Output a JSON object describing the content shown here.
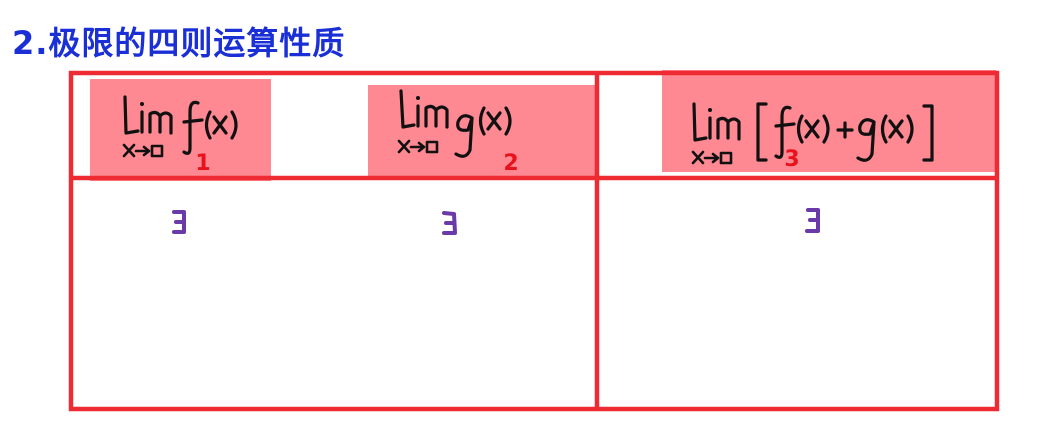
{
  "title": "2.极限的四则运算性质",
  "cells": [
    {
      "expression": "lim x→□ f(x)",
      "marker": "1",
      "content": "∃"
    },
    {
      "expression": "lim x→□ g(x)",
      "marker": "2",
      "content": "∃"
    },
    {
      "expression": "lim x→□ [f(x)+g(x)]",
      "marker": "3",
      "content": "∃"
    }
  ],
  "colors": {
    "title": "#1a2fd6",
    "grid": "#ee2b33",
    "highlight": "#ff3b4a",
    "marker": "#e8121c",
    "ink": "#111111",
    "exists_symbol": "#6a3aa8"
  }
}
